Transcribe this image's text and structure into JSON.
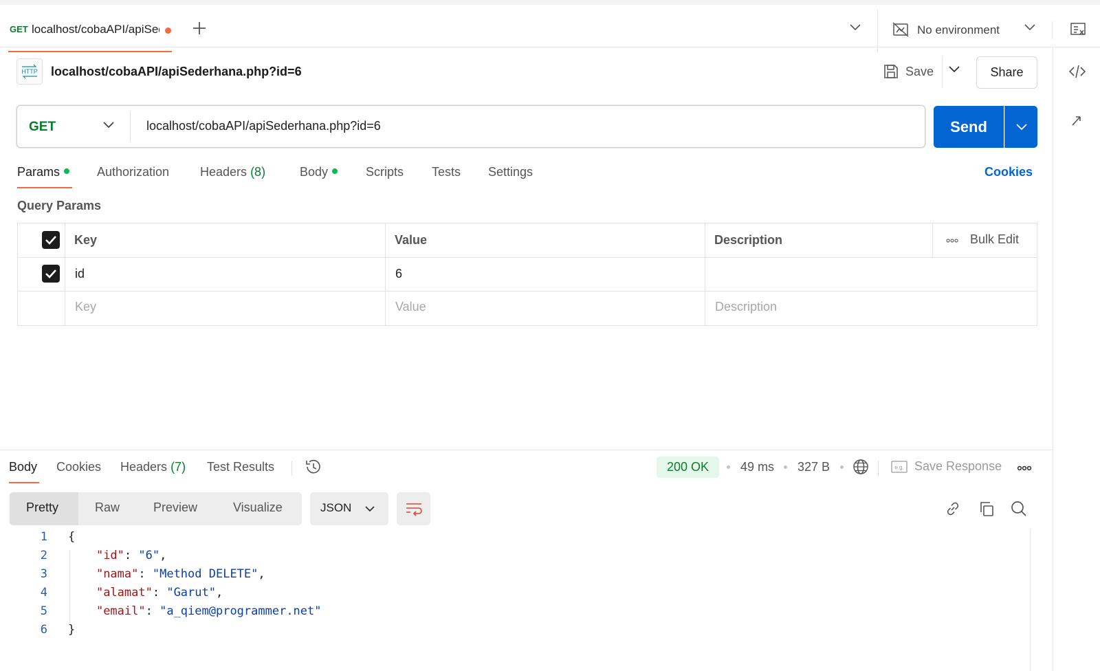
{
  "tab": {
    "method": "GET",
    "name": "localhost/cobaAPI/apiSederhana.php?id=6"
  },
  "environment": {
    "label": "No environment"
  },
  "request": {
    "title": "localhost/cobaAPI/apiSederhana.php?id=6",
    "badge": "HTTP",
    "method": "GET",
    "url": "localhost/cobaAPI/apiSederhana.php?id=6",
    "save_label": "Save",
    "share_label": "Share",
    "send_label": "Send"
  },
  "request_tabs": [
    {
      "label": "Params",
      "dot": true
    },
    {
      "label": "Authorization"
    },
    {
      "label": "Headers",
      "count": "(8)"
    },
    {
      "label": "Body",
      "dot": true
    },
    {
      "label": "Scripts"
    },
    {
      "label": "Tests"
    },
    {
      "label": "Settings"
    }
  ],
  "cookies_label": "Cookies",
  "query_params": {
    "title": "Query Params",
    "headers": {
      "key": "Key",
      "value": "Value",
      "description": "Description",
      "bulk_edit": "Bulk Edit"
    },
    "rows": [
      {
        "checked": true,
        "key": "id",
        "value": "6",
        "description": ""
      }
    ],
    "placeholders": {
      "key": "Key",
      "value": "Value",
      "description": "Description"
    }
  },
  "response": {
    "tabs": [
      {
        "label": "Body"
      },
      {
        "label": "Cookies"
      },
      {
        "label": "Headers",
        "count": "(7)"
      },
      {
        "label": "Test Results"
      }
    ],
    "status": "200 OK",
    "time": "49 ms",
    "size": "327 B",
    "save_response_label": "Save Response",
    "formats": [
      "Pretty",
      "Raw",
      "Preview",
      "Visualize"
    ],
    "language": "JSON",
    "body_lines": [
      {
        "n": "1",
        "text": "{"
      },
      {
        "n": "2",
        "key": "\"id\"",
        "val": "\"6\"",
        "trail": ","
      },
      {
        "n": "3",
        "key": "\"nama\"",
        "val": "\"Method DELETE\"",
        "trail": ","
      },
      {
        "n": "4",
        "key": "\"alamat\"",
        "val": "\"Garut\"",
        "trail": ","
      },
      {
        "n": "5",
        "key": "\"email\"",
        "val": "\"a_qiem@programmer.net\"",
        "trail": ""
      },
      {
        "n": "6",
        "text": "}"
      }
    ]
  },
  "colors": {
    "accent": "#f26b3a",
    "send": "#0265d2",
    "method_get": "#0a7d2c",
    "status_ok_bg": "#e4f7ea"
  }
}
